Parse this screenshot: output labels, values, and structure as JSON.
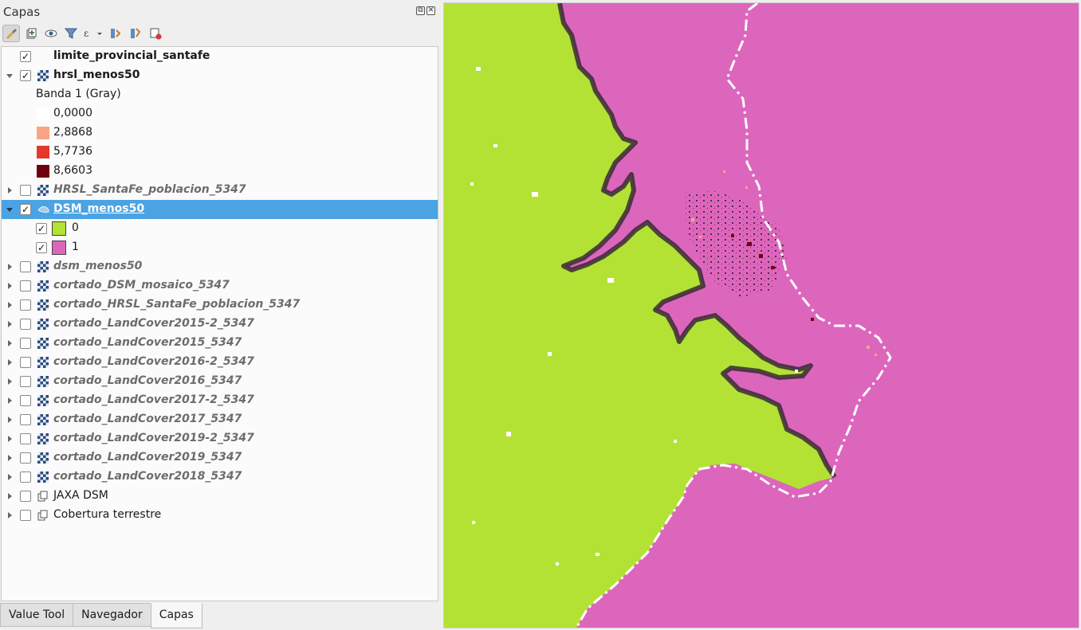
{
  "panel": {
    "title": "Capas",
    "window_buttons": [
      "⧉",
      "✕"
    ]
  },
  "toolbar": {
    "buttons": [
      {
        "name": "style-brush-icon"
      },
      {
        "name": "add-group-icon"
      },
      {
        "name": "visibility-eye-icon"
      },
      {
        "name": "filter-legend-icon"
      },
      {
        "name": "filter-expression-icon"
      },
      {
        "name": "expand-all-icon"
      },
      {
        "name": "collapse-all-icon"
      },
      {
        "name": "remove-layer-icon"
      }
    ]
  },
  "layers": [
    {
      "label": "limite_provincial_santafe",
      "checked": true,
      "style": "bold",
      "icon": "none",
      "arrow": "none",
      "indent": 0
    },
    {
      "label": "hrsl_menos50",
      "checked": true,
      "style": "bold",
      "icon": "raster",
      "arrow": "down",
      "indent": 0
    },
    {
      "label": "Banda 1 (Gray)",
      "type": "legend-header",
      "indent": 1
    },
    {
      "label": "0,0000",
      "type": "legend-item",
      "color": "#ffffff",
      "indent": 1
    },
    {
      "label": "2,8868",
      "type": "legend-item",
      "color": "#f7a585",
      "indent": 1
    },
    {
      "label": "5,7736",
      "type": "legend-item",
      "color": "#e3392c",
      "indent": 1
    },
    {
      "label": "8,6603",
      "type": "legend-item",
      "color": "#6e0011",
      "indent": 1
    },
    {
      "label": "HRSL_SantaFe_poblacion_5347",
      "checked": false,
      "style": "grey",
      "icon": "raster",
      "arrow": "right",
      "indent": 0
    },
    {
      "label": "DSM_menos50",
      "checked": true,
      "style": "selected",
      "icon": "vector",
      "arrow": "down",
      "indent": 0
    },
    {
      "label": "0",
      "type": "class-item",
      "checked": true,
      "color": "#b3e235",
      "indent": 1
    },
    {
      "label": "1",
      "type": "class-item",
      "checked": true,
      "color": "#dd66bd",
      "indent": 1
    },
    {
      "label": "dsm_menos50",
      "checked": false,
      "style": "grey",
      "icon": "raster",
      "arrow": "right",
      "indent": 0
    },
    {
      "label": "cortado_DSM_mosaico_5347",
      "checked": false,
      "style": "grey",
      "icon": "raster",
      "arrow": "right",
      "indent": 0
    },
    {
      "label": "cortado_HRSL_SantaFe_poblacion_5347",
      "checked": false,
      "style": "grey",
      "icon": "raster",
      "arrow": "right",
      "indent": 0
    },
    {
      "label": "cortado_LandCover2015-2_5347",
      "checked": false,
      "style": "grey",
      "icon": "raster",
      "arrow": "right",
      "indent": 0
    },
    {
      "label": "cortado_LandCover2015_5347",
      "checked": false,
      "style": "grey",
      "icon": "raster",
      "arrow": "right",
      "indent": 0
    },
    {
      "label": "cortado_LandCover2016-2_5347",
      "checked": false,
      "style": "grey",
      "icon": "raster",
      "arrow": "right",
      "indent": 0
    },
    {
      "label": "cortado_LandCover2016_5347",
      "checked": false,
      "style": "grey",
      "icon": "raster",
      "arrow": "right",
      "indent": 0
    },
    {
      "label": "cortado_LandCover2017-2_5347",
      "checked": false,
      "style": "grey",
      "icon": "raster",
      "arrow": "right",
      "indent": 0
    },
    {
      "label": "cortado_LandCover2017_5347",
      "checked": false,
      "style": "grey",
      "icon": "raster",
      "arrow": "right",
      "indent": 0
    },
    {
      "label": "cortado_LandCover2019-2_5347",
      "checked": false,
      "style": "grey",
      "icon": "raster",
      "arrow": "right",
      "indent": 0
    },
    {
      "label": "cortado_LandCover2019_5347",
      "checked": false,
      "style": "grey",
      "icon": "raster",
      "arrow": "right",
      "indent": 0
    },
    {
      "label": "cortado_LandCover2018_5347",
      "checked": false,
      "style": "grey",
      "icon": "raster",
      "arrow": "right",
      "indent": 0
    },
    {
      "label": "JAXA DSM",
      "checked": false,
      "style": "group",
      "icon": "group",
      "arrow": "right",
      "indent": 0
    },
    {
      "label": "Cobertura terrestre",
      "checked": false,
      "style": "group",
      "icon": "group",
      "arrow": "right",
      "indent": 0
    }
  ],
  "tabs": [
    {
      "label": "Value Tool",
      "active": false
    },
    {
      "label": "Navegador",
      "active": false
    },
    {
      "label": "Capas",
      "active": true
    }
  ],
  "map": {
    "land_color": "#b3e235",
    "water_color": "#dd66bd",
    "boundary_color": "#ffffff",
    "dark_fringe_color": "#3a2a36"
  }
}
